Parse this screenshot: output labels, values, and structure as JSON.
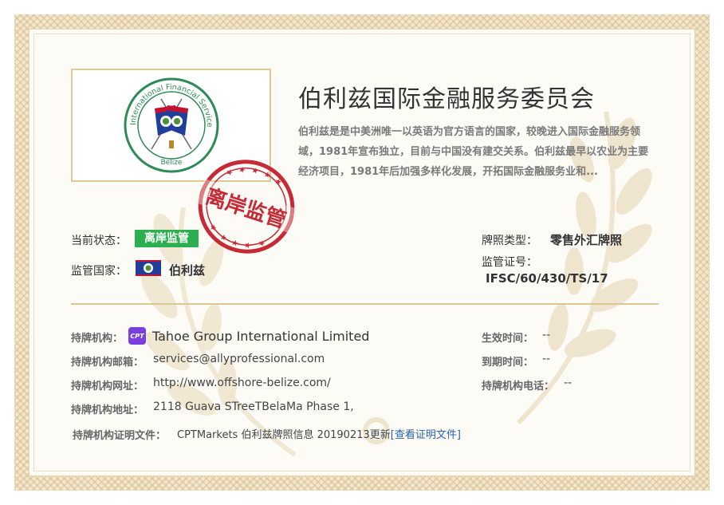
{
  "header": {
    "title": "伯利兹国际金融服务委员会",
    "description": "伯利兹是是中美洲唯一以英语为官方语言的国家，较晚进入国际金融服务领域，1981年宣布独立，目前与中国没有建交关系。伯利兹最早以农业为主要经济项目，1981年后加强多样化发展，开拓国际金融服务业和..."
  },
  "logo": {
    "ring_text": "International Financial Services Commission",
    "bottom_text": "Belize"
  },
  "stamp": {
    "text": "离岸监管"
  },
  "status": {
    "current_label": "当前状态：",
    "current_value": "离岸监管",
    "country_label": "监管国家：",
    "country_value": "伯利兹",
    "license_type_label": "牌照类型：",
    "license_type_value": "零售外汇牌照",
    "license_no_label": "监管证号：",
    "license_no_value": "IFSC/60/430/TS/17"
  },
  "details": {
    "holder_label": "持牌机构：",
    "holder_icon_text": "CPT",
    "holder_value": "Tahoe Group International Limited",
    "email_label": "持牌机构邮箱：",
    "email_value": "services@allyprofessional.com",
    "website_label": "持牌机构网址：",
    "website_value": "http://www.offshore-belize.com/",
    "address_label": "持牌机构地址：",
    "address_value": "2118 Guava STreeTBelaMa Phase 1,",
    "cert_label": "持牌机构证明文件：",
    "cert_value": "CPTMarkets 伯利兹牌照信息 20190213更新",
    "cert_link": "[查看证明文件]",
    "effective_label": "生效时间：",
    "effective_value": "--",
    "expiry_label": "到期时间：",
    "expiry_value": "--",
    "phone_label": "持牌机构电话：",
    "phone_value": "--"
  },
  "colors": {
    "badge_green": "#2cb04f",
    "stamp_red": "#c62a35",
    "border_gold": "#dcc693",
    "link_blue": "#2b62b0"
  }
}
